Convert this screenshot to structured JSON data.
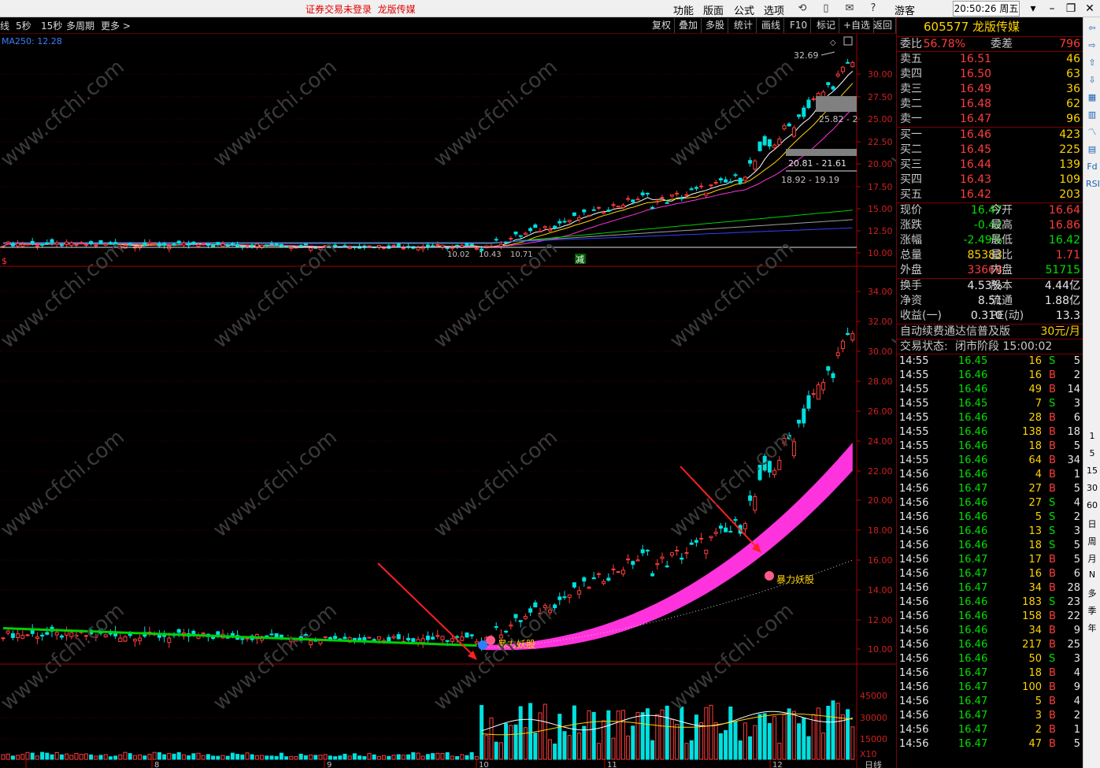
{
  "titlebar": {
    "notice": "证券交易未登录",
    "stock_name": "龙版传媒",
    "menus": [
      "功能",
      "版面",
      "公式",
      "选项"
    ],
    "quick_add": "+自选",
    "guest": "游客",
    "clock": "20:50:26 周五"
  },
  "periodbar": {
    "periods": [
      "线",
      "5秒",
      "15秒",
      "多周期",
      "更多 >"
    ],
    "tools": [
      "复权",
      "叠加",
      "多股",
      "统计",
      "画线",
      "F10",
      "标记",
      "+自选",
      "返回"
    ],
    "ma_label": "MA250: 12.28"
  },
  "main_chart": {
    "price_ticks": [
      "30.00",
      "27.50",
      "25.00",
      "22.50",
      "20.00",
      "17.50",
      "15.00",
      "12.50",
      "10.00"
    ],
    "high_label": "32.69",
    "zone_labels": [
      "25.82 - 2",
      "20.81 - 21.61",
      "18.92 - 19.19"
    ],
    "low_labels": [
      "10.02",
      "10.43",
      "10.71"
    ],
    "reduce_label": "减",
    "watermark": "www.cfchi.com"
  },
  "sub_chart": {
    "price_ticks": [
      "34.00",
      "32.00",
      "30.00",
      "28.00",
      "26.00",
      "24.00",
      "22.00",
      "20.00",
      "18.00",
      "16.00",
      "14.00",
      "12.00",
      "10.00"
    ],
    "signal_labels": [
      "暴力妖股",
      "暴力妖股"
    ]
  },
  "volume_chart": {
    "ticks": [
      "45000",
      "30000",
      "15000"
    ],
    "multiplier": "X10",
    "months": [
      "8",
      "9",
      "10",
      "11",
      "12"
    ],
    "period_label": "日线"
  },
  "quote": {
    "code": "605577",
    "name": "龙版传媒",
    "weibi_label": "委比",
    "weibi": "56.78%",
    "weicha_label": "委差",
    "weicha": "796",
    "asks": [
      {
        "label": "卖五",
        "price": "16.51",
        "vol": "46"
      },
      {
        "label": "卖四",
        "price": "16.50",
        "vol": "63"
      },
      {
        "label": "卖三",
        "price": "16.49",
        "vol": "36"
      },
      {
        "label": "卖二",
        "price": "16.48",
        "vol": "62"
      },
      {
        "label": "卖一",
        "price": "16.47",
        "vol": "96"
      }
    ],
    "bids": [
      {
        "label": "买一",
        "price": "16.46",
        "vol": "423"
      },
      {
        "label": "买二",
        "price": "16.45",
        "vol": "225"
      },
      {
        "label": "买三",
        "price": "16.44",
        "vol": "139"
      },
      {
        "label": "买四",
        "price": "16.43",
        "vol": "109"
      },
      {
        "label": "买五",
        "price": "16.42",
        "vol": "203"
      }
    ],
    "stats": [
      {
        "l1": "现价",
        "v1": "16.47",
        "c1": "green",
        "l2": "今开",
        "v2": "16.64",
        "c2": "red"
      },
      {
        "l1": "涨跌",
        "v1": "-0.42",
        "c1": "green",
        "l2": "最高",
        "v2": "16.86",
        "c2": "red"
      },
      {
        "l1": "涨幅",
        "v1": "-2.49%",
        "c1": "green",
        "l2": "最低",
        "v2": "16.42",
        "c2": "green"
      },
      {
        "l1": "总量",
        "v1": "85383",
        "c1": "yellow",
        "l2": "量比",
        "v2": "1.71",
        "c2": "red"
      },
      {
        "l1": "外盘",
        "v1": "33668",
        "c1": "red",
        "l2": "内盘",
        "v2": "51715",
        "c2": "green"
      }
    ],
    "fundamentals": [
      {
        "l1": "换手",
        "v1": "4.53%",
        "l2": "股本",
        "v2": "4.44亿"
      },
      {
        "l1": "净资",
        "v1": "8.51",
        "l2": "流通",
        "v2": "1.88亿"
      },
      {
        "l1": "收益(一)",
        "v1": "0.310",
        "l2": "PE(动)",
        "v2": "13.3"
      }
    ],
    "promo": "自动续费通达信普及版",
    "promo_price": "30元/月",
    "trade_status_label": "交易状态:",
    "trade_status": "闭市阶段 15:00:02",
    "ticks": [
      {
        "t": "14:55",
        "p": "16.45",
        "v": "16",
        "s": "S",
        "n": "5"
      },
      {
        "t": "14:55",
        "p": "16.46",
        "v": "16",
        "s": "B",
        "n": "2"
      },
      {
        "t": "14:55",
        "p": "16.46",
        "v": "49",
        "s": "B",
        "n": "14"
      },
      {
        "t": "14:55",
        "p": "16.45",
        "v": "7",
        "s": "S",
        "n": "3"
      },
      {
        "t": "14:55",
        "p": "16.46",
        "v": "28",
        "s": "B",
        "n": "6"
      },
      {
        "t": "14:55",
        "p": "16.46",
        "v": "138",
        "s": "B",
        "n": "18"
      },
      {
        "t": "14:55",
        "p": "16.46",
        "v": "18",
        "s": "B",
        "n": "5"
      },
      {
        "t": "14:55",
        "p": "16.46",
        "v": "64",
        "s": "B",
        "n": "34"
      },
      {
        "t": "14:56",
        "p": "16.46",
        "v": "4",
        "s": "B",
        "n": "1"
      },
      {
        "t": "14:56",
        "p": "16.47",
        "v": "27",
        "s": "B",
        "n": "5"
      },
      {
        "t": "14:56",
        "p": "16.46",
        "v": "27",
        "s": "S",
        "n": "4"
      },
      {
        "t": "14:56",
        "p": "16.46",
        "v": "5",
        "s": "S",
        "n": "2"
      },
      {
        "t": "14:56",
        "p": "16.46",
        "v": "13",
        "s": "S",
        "n": "3"
      },
      {
        "t": "14:56",
        "p": "16.46",
        "v": "18",
        "s": "S",
        "n": "5"
      },
      {
        "t": "14:56",
        "p": "16.47",
        "v": "17",
        "s": "B",
        "n": "5"
      },
      {
        "t": "14:56",
        "p": "16.47",
        "v": "16",
        "s": "B",
        "n": "6"
      },
      {
        "t": "14:56",
        "p": "16.47",
        "v": "34",
        "s": "B",
        "n": "28"
      },
      {
        "t": "14:56",
        "p": "16.46",
        "v": "183",
        "s": "S",
        "n": "23"
      },
      {
        "t": "14:56",
        "p": "16.46",
        "v": "158",
        "s": "B",
        "n": "22"
      },
      {
        "t": "14:56",
        "p": "16.46",
        "v": "34",
        "s": "B",
        "n": "9"
      },
      {
        "t": "14:56",
        "p": "16.46",
        "v": "217",
        "s": "B",
        "n": "25"
      },
      {
        "t": "14:56",
        "p": "16.46",
        "v": "50",
        "s": "S",
        "n": "3"
      },
      {
        "t": "14:56",
        "p": "16.47",
        "v": "18",
        "s": "B",
        "n": "4"
      },
      {
        "t": "14:56",
        "p": "16.47",
        "v": "100",
        "s": "B",
        "n": "9"
      },
      {
        "t": "14:56",
        "p": "16.47",
        "v": "5",
        "s": "B",
        "n": "4"
      },
      {
        "t": "14:56",
        "p": "16.47",
        "v": "3",
        "s": "B",
        "n": "2"
      },
      {
        "t": "14:56",
        "p": "16.47",
        "v": "2",
        "s": "B",
        "n": "1"
      },
      {
        "t": "14:56",
        "p": "16.47",
        "v": "47",
        "s": "B",
        "n": "5"
      }
    ]
  },
  "sidetools": {
    "labels": [
      "1",
      "5",
      "15",
      "30",
      "60",
      "日",
      "周",
      "月",
      "N",
      "多",
      "季",
      "年"
    ],
    "icons": [
      "arrow-left-icon",
      "arrow-right-icon",
      "arrow-up-icon",
      "arrow-down-icon",
      "bar-chart-icon",
      "candle-icon",
      "line-chart-icon",
      "table-icon",
      "fund-icon",
      "rsi-icon"
    ]
  },
  "colors": {
    "up": "#ff3c3c",
    "down": "#00e0e0",
    "ma_band": "#ff33dd",
    "axis": "#c00000"
  }
}
